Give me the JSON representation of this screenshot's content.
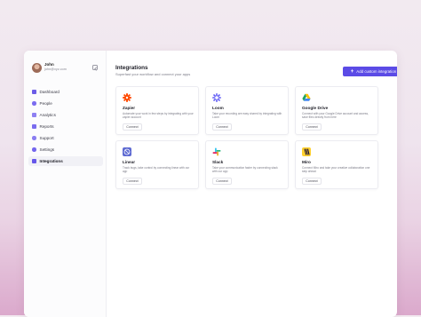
{
  "sidebar": {
    "user": {
      "name": "John",
      "email": "john@xyz.com"
    },
    "items": [
      {
        "label": "Dashboard",
        "icon": "dashboard-icon",
        "color": "#6c5ce7"
      },
      {
        "label": "People",
        "icon": "people-icon",
        "color": "#7b6cf0"
      },
      {
        "label": "Analytics",
        "icon": "analytics-icon",
        "color": "#8e80f2"
      },
      {
        "label": "Reports",
        "icon": "reports-icon",
        "color": "#7a6cef"
      },
      {
        "label": "Support",
        "icon": "support-icon",
        "color": "#8a7df1"
      },
      {
        "label": "Settings",
        "icon": "settings-icon",
        "color": "#7466ee"
      },
      {
        "label": "Integrations",
        "icon": "integrations-icon",
        "color": "#6656ea",
        "active": true
      }
    ]
  },
  "header": {
    "title": "Integrations",
    "subtitle": "Superfast your workflow and connect your apps",
    "add_button_label": "Add custom integration"
  },
  "integrations": [
    {
      "name": "Zapier",
      "description": "Automate your work in few steps by integrating with your zapier account",
      "button": "Connect",
      "icon": "zapier-icon",
      "color": "#ff4a00"
    },
    {
      "name": "Loom",
      "description": "Take your recording are easy shared by integrating with Loom",
      "button": "Connect",
      "icon": "loom-icon",
      "color": "#625df5"
    },
    {
      "name": "Google Drive",
      "description": "Connect with your Google Drive account and access, save files directly from here",
      "button": "Connect",
      "icon": "google-drive-icon",
      "color": "#1fa463"
    },
    {
      "name": "Linear",
      "description": "Track bugs, take control by connecting linear with our app",
      "button": "Connect",
      "icon": "linear-icon",
      "color": "#5e6ad2"
    },
    {
      "name": "Slack",
      "description": "Take your communication faster by connecting slack with our app",
      "button": "Connect",
      "icon": "slack-icon",
      "color": "#e01e5a"
    },
    {
      "name": "Miro",
      "description": "Connect Miro and take your creative collaboration one step ahead",
      "button": "Connect",
      "icon": "miro-icon",
      "color": "#ffd02f"
    }
  ],
  "colors": {
    "accent": "#5b4be6",
    "background_gradient_bottom": "#dba9cc"
  }
}
